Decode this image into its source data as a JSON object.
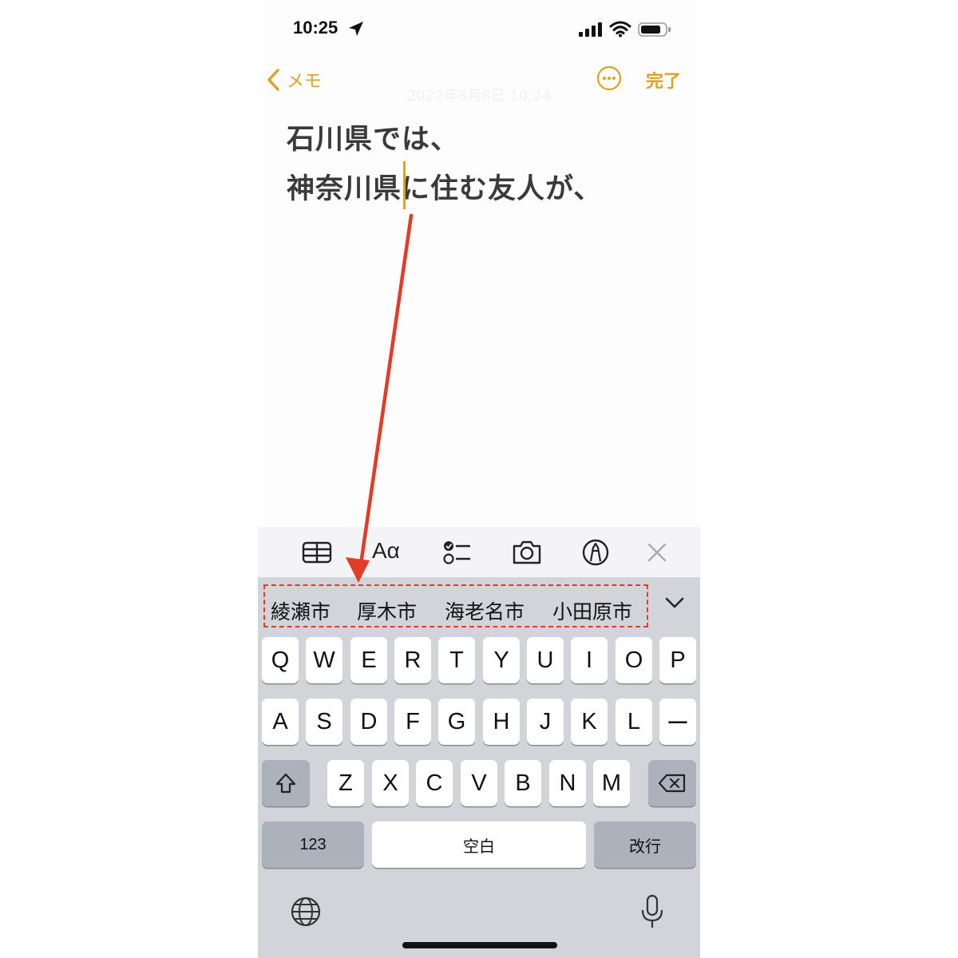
{
  "status_bar": {
    "time": "10:25"
  },
  "nav": {
    "back_label": "メモ",
    "done_label": "完了"
  },
  "note": {
    "date": "2022年8月8日 10:24",
    "lines": [
      "石川県では、",
      "神奈川県に住む友人が、"
    ]
  },
  "toolbar": {
    "format_label": "Aα"
  },
  "keyboard": {
    "candidates": [
      "綾瀬市",
      "厚木市",
      "海老名市",
      "小田原市"
    ],
    "row1": [
      "Q",
      "W",
      "E",
      "R",
      "T",
      "Y",
      "U",
      "I",
      "O",
      "P"
    ],
    "row2": [
      "A",
      "S",
      "D",
      "F",
      "G",
      "H",
      "J",
      "K",
      "L",
      "ー"
    ],
    "row3": [
      "Z",
      "X",
      "C",
      "V",
      "B",
      "N",
      "M"
    ],
    "numbers_label": "123",
    "space_label": "空白",
    "return_label": "改行"
  },
  "colors": {
    "accent": "#d9a424",
    "annotation": "#e23b26",
    "keyboard_bg": "#d2d4da"
  }
}
